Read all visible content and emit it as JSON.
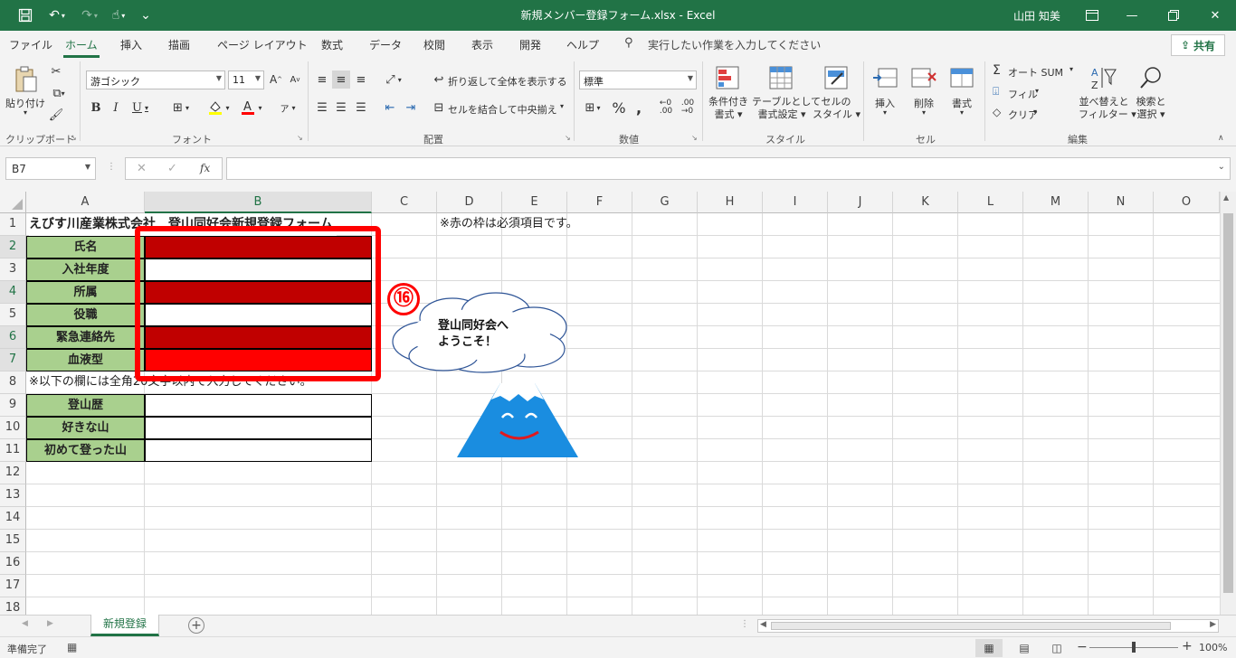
{
  "window": {
    "title": "新規メンバー登録フォーム.xlsx  -  Excel",
    "user": "山田 知美"
  },
  "menu": {
    "tabs": [
      "ファイル",
      "ホーム",
      "挿入",
      "描画",
      "ページ レイアウト",
      "数式",
      "データ",
      "校閲",
      "表示",
      "開発",
      "ヘルプ"
    ],
    "active_tab": "ホーム",
    "tellme": "実行したい作業を入力してください",
    "share": "共有"
  },
  "ribbon": {
    "clipboard": {
      "paste": "貼り付け",
      "group": "クリップボード"
    },
    "font": {
      "name": "游ゴシック",
      "size": "11",
      "group": "フォント"
    },
    "alignment": {
      "wrap": "折り返して全体を表示する",
      "merge": "セルを結合して中央揃え",
      "group": "配置"
    },
    "number": {
      "format": "標準",
      "group": "数値"
    },
    "styles": {
      "conditional": [
        "条件付き",
        "書式 ▾"
      ],
      "table": [
        "テーブルとして",
        "書式設定 ▾"
      ],
      "cell": [
        "セルの",
        "スタイル ▾"
      ],
      "group": "スタイル"
    },
    "cells": {
      "insert": "挿入",
      "delete": "削除",
      "format": "書式",
      "group": "セル"
    },
    "editing": {
      "autosum": "オート SUM",
      "fill": "フィル",
      "clear": "クリア",
      "sort": [
        "並べ替えと",
        "フィルター ▾"
      ],
      "find": [
        "検索と",
        "選択 ▾"
      ],
      "group": "編集"
    }
  },
  "formula_bar": {
    "name_box": "B7",
    "fx": "fx",
    "value": ""
  },
  "grid": {
    "columns": [
      "A",
      "B",
      "C",
      "D",
      "E",
      "F",
      "G",
      "H",
      "I",
      "J",
      "K",
      "L",
      "M",
      "N",
      "O"
    ],
    "rows": [
      "1",
      "2",
      "3",
      "4",
      "5",
      "6",
      "7",
      "8",
      "9",
      "10",
      "11",
      "12",
      "13",
      "14",
      "15",
      "16",
      "17",
      "18"
    ],
    "selected_column": "B",
    "selected_rows": [
      "2",
      "4",
      "6",
      "7"
    ],
    "cells": {
      "a1": "えびす川産業株式会社　登山同好会新規登録フォーム",
      "a2": "氏名",
      "a3": "入社年度",
      "a4": "所属",
      "a5": "役職",
      "a6": "緊急連絡先",
      "a7": "血液型",
      "a8": "※以下の欄には全角20文字以内で入力してください。",
      "a9": "登山歴",
      "a10": "好きな山",
      "a11": "初めて登った山",
      "d1": "※赤の枠は必須項目です。"
    }
  },
  "annotations": {
    "step_number": "⑯",
    "cloud_line1": "登山同好会へ",
    "cloud_line2": "ようこそ！"
  },
  "colors": {
    "excel_green": "#217346",
    "label_green": "#a9d08e",
    "dark_red": "#c00000",
    "bright_red": "#ff0000",
    "highlight_frame": "#ff0000",
    "mountain_blue": "#1a8de0"
  },
  "sheet_tabs": [
    "新規登録"
  ],
  "status": {
    "ready": "準備完了",
    "zoom": "100%"
  }
}
